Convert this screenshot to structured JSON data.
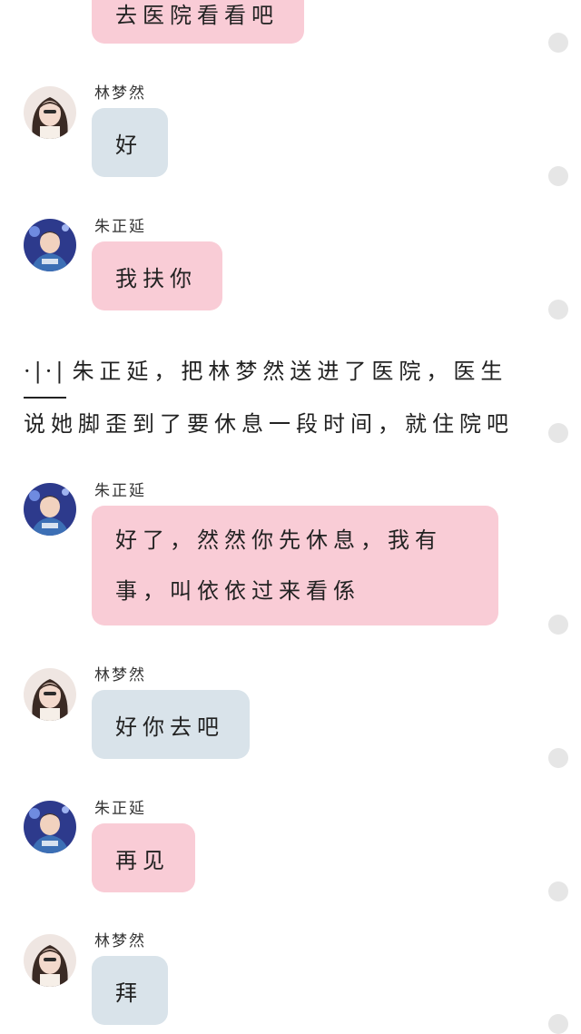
{
  "messages": [
    {
      "sender": "",
      "text": "去医院看看吧",
      "style": "pink"
    },
    {
      "sender": "林梦然",
      "text": "好",
      "style": "blue"
    },
    {
      "sender": "朱正延",
      "text": "我扶你",
      "style": "pink"
    },
    {
      "sender": "朱正延",
      "lines": [
        "好了，然然你先休息，我有",
        "事，叫依依过来看係"
      ],
      "style": "pink"
    },
    {
      "sender": "林梦然",
      "text": "好你去吧",
      "style": "blue"
    },
    {
      "sender": "朱正延",
      "text": "再见",
      "style": "pink"
    },
    {
      "sender": "林梦然",
      "text": "拜",
      "style": "blue"
    }
  ],
  "narration": {
    "marks": "·|·|",
    "line1": "朱正延，把林梦然送进了医院，医生",
    "line2": "说她脚歪到了要休息一段时间，就住院吧"
  },
  "avatars": {
    "linmengran": "girl-avatar-icon",
    "zhuzhengyan": "boy-avatar-icon"
  },
  "colors": {
    "pink_bubble": "#f9ccd6",
    "blue_bubble": "#d9e3ea",
    "dot": "#e6e6e6"
  }
}
